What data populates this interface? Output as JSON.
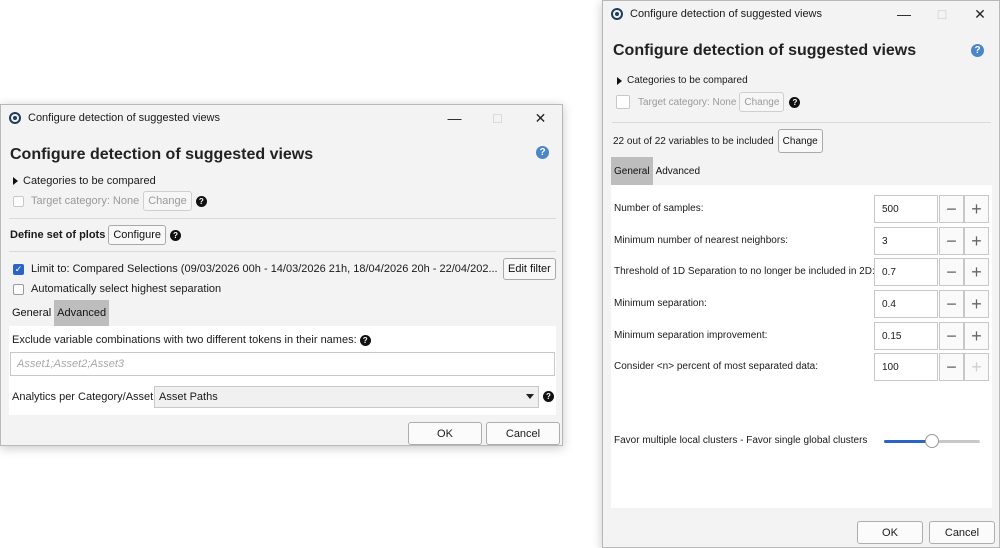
{
  "dialog_left": {
    "title": "Configure detection of suggested views",
    "heading": "Configure detection of suggested views",
    "categories_label": "Categories to be compared",
    "target_category_label": "Target category: None",
    "change_label": "Change",
    "define_plots_label": "Define set of plots",
    "configure_label": "Configure",
    "limit_label": "Limit to: Compared Selections (09/03/2026 00h - 14/03/2026 21h, 18/04/2026 20h - 22/04/202...",
    "limit_checked": true,
    "edit_filter_label": "Edit filter",
    "auto_select_label": "Automatically select highest separation",
    "tabs": [
      {
        "label": "General"
      },
      {
        "label": "Advanced"
      }
    ],
    "active_tab": "Advanced",
    "exclude_label": "Exclude variable combinations with two different tokens in their names:",
    "exclude_placeholder": "Asset1;Asset2;Asset3",
    "analytics_label": "Analytics per Category/Asset",
    "analytics_value": "Asset Paths",
    "ok_label": "OK",
    "cancel_label": "Cancel"
  },
  "dialog_right": {
    "title": "Configure detection of suggested views",
    "heading": "Configure detection of suggested views",
    "categories_label": "Categories to be compared",
    "target_category_label": "Target category: None",
    "change_label": "Change",
    "variables_label": "22 out of 22 variables to be included",
    "variables_change_label": "Change",
    "tabs": [
      {
        "label": "General"
      },
      {
        "label": "Advanced"
      }
    ],
    "active_tab": "General",
    "params": [
      {
        "label": "Number of samples:",
        "value": "500"
      },
      {
        "label": "Minimum number of nearest neighbors:",
        "value": "3"
      },
      {
        "label": "Threshold of 1D Separation to no longer be included in 2D:",
        "value": "0.7"
      },
      {
        "label": "Minimum separation:",
        "value": "0.4"
      },
      {
        "label": "Minimum separation improvement:",
        "value": "0.15"
      },
      {
        "label": "Consider <n> percent of most separated data:",
        "value": "100"
      }
    ],
    "slider_label": "Favor multiple local clusters - Favor single global clusters",
    "slider_value": 0.5,
    "ok_label": "OK",
    "cancel_label": "Cancel"
  },
  "icons": {
    "app": "app-logo-icon",
    "help": "help-icon",
    "question": "question-icon",
    "minimize": "minimize-icon",
    "maximize": "maximize-icon",
    "close": "close-icon",
    "expand": "expand-triangle-icon",
    "plus": "plus-icon",
    "minus": "minus-icon",
    "dropdown": "chevron-down-icon"
  },
  "colors": {
    "accent": "#2a64c5",
    "help": "#4a86c8",
    "tab_active": "#bdbdbd"
  }
}
